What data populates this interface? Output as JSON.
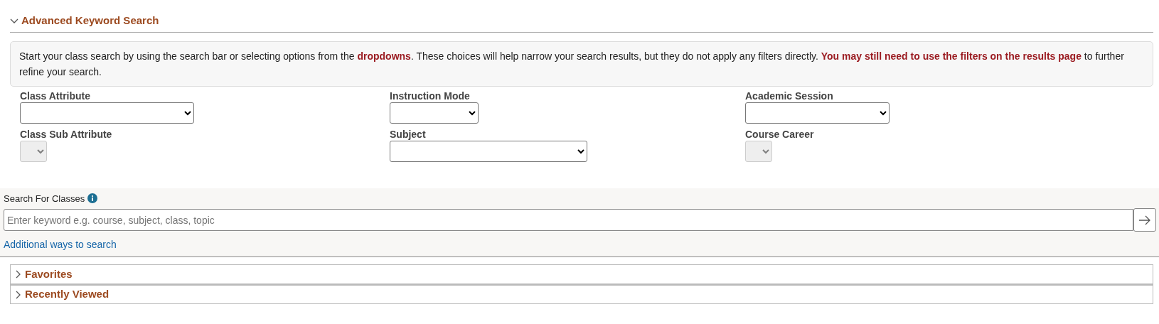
{
  "advanced_search": {
    "title": "Advanced Keyword Search",
    "expanded": true,
    "info": "Start your class search by using the search bar or selecting options from the **dropdowns**. These choices will help narrow your search results, but they do not apply any filters directly. **You may still need to use the filters on the results page** to further refine your search.",
    "fields": [
      {
        "label": "Class Attribute",
        "disabled": false
      },
      {
        "label": "Instruction Mode",
        "disabled": false
      },
      {
        "label": "Academic Session",
        "disabled": false
      },
      {
        "label": "Class Sub Attribute",
        "disabled": true
      },
      {
        "label": "Subject",
        "disabled": false
      },
      {
        "label": "Course Career",
        "disabled": true
      }
    ]
  },
  "search": {
    "label": "Search For Classes",
    "placeholder": "Enter keyword e.g. course, subject, class, topic",
    "link": "Additional ways to search"
  },
  "sections": [
    {
      "title": "Favorites",
      "expanded": false
    },
    {
      "title": "Recently Viewed",
      "expanded": false
    }
  ]
}
